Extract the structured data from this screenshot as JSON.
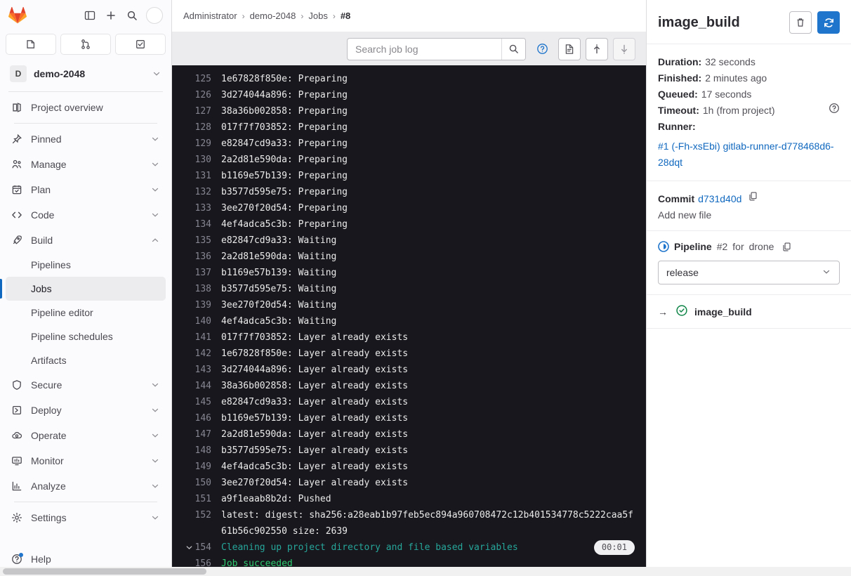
{
  "sidebar": {
    "logo_icon": "gitlab-logo",
    "top_buttons": [
      {
        "name": "toggle-sidebar-button",
        "icon": "panel-icon"
      },
      {
        "name": "create-new-button",
        "icon": "plus-icon"
      },
      {
        "name": "search-button",
        "icon": "search-icon"
      }
    ],
    "avatar": "user-avatar",
    "tabs": [
      {
        "name": "issues-tab",
        "icon": "issues-icon"
      },
      {
        "name": "merge-requests-tab",
        "icon": "merge-request-icon"
      },
      {
        "name": "todos-tab",
        "icon": "todo-checkbox-icon"
      }
    ],
    "project": {
      "badge": "D",
      "name": "demo-2048",
      "chevron": "chevron-down-icon"
    },
    "overview_label": "Project overview",
    "items": [
      {
        "label": "Pinned",
        "icon": "pin-icon",
        "expandable": true,
        "expanded": false
      },
      {
        "label": "Manage",
        "icon": "users-icon",
        "expandable": true,
        "expanded": false
      },
      {
        "label": "Plan",
        "icon": "calendar-icon",
        "expandable": true,
        "expanded": false
      },
      {
        "label": "Code",
        "icon": "code-icon",
        "expandable": true,
        "expanded": false
      },
      {
        "label": "Build",
        "icon": "rocket-icon",
        "expandable": true,
        "expanded": true
      },
      {
        "label": "Secure",
        "icon": "shield-icon",
        "expandable": true,
        "expanded": false
      },
      {
        "label": "Deploy",
        "icon": "deploy-icon",
        "expandable": true,
        "expanded": false
      },
      {
        "label": "Operate",
        "icon": "cloud-gear-icon",
        "expandable": true,
        "expanded": false
      },
      {
        "label": "Monitor",
        "icon": "monitor-icon",
        "expandable": true,
        "expanded": false
      },
      {
        "label": "Analyze",
        "icon": "chart-icon",
        "expandable": true,
        "expanded": false
      },
      {
        "label": "Settings",
        "icon": "gear-icon",
        "expandable": true,
        "expanded": false
      }
    ],
    "build_subitems": [
      {
        "label": "Pipelines",
        "active": false
      },
      {
        "label": "Jobs",
        "active": true
      },
      {
        "label": "Pipeline editor",
        "active": false
      },
      {
        "label": "Pipeline schedules",
        "active": false
      },
      {
        "label": "Artifacts",
        "active": false
      }
    ],
    "help_label": "Help"
  },
  "breadcrumb": {
    "items": [
      "Administrator",
      "demo-2048",
      "Jobs"
    ],
    "current": "#8",
    "separator": "›"
  },
  "toolbar": {
    "search_placeholder": "Search job log",
    "search_value": "",
    "buttons": [
      {
        "name": "search-submit-button",
        "icon": "search-icon"
      },
      {
        "name": "job-log-help-button",
        "icon": "question-circle-icon"
      },
      {
        "name": "raw-log-button",
        "icon": "document-icon"
      },
      {
        "name": "scroll-to-top-button",
        "icon": "arrow-up-icon"
      },
      {
        "name": "scroll-to-bottom-button",
        "icon": "arrow-down-icon"
      }
    ]
  },
  "job_log": {
    "lines": [
      {
        "num": "125",
        "text": "1e67828f850e: Preparing",
        "style": "plain"
      },
      {
        "num": "126",
        "text": "3d274044a896: Preparing",
        "style": "plain"
      },
      {
        "num": "127",
        "text": "38a36b002858: Preparing",
        "style": "plain"
      },
      {
        "num": "128",
        "text": "017f7f703852: Preparing",
        "style": "plain"
      },
      {
        "num": "129",
        "text": "e82847cd9a33: Preparing",
        "style": "plain"
      },
      {
        "num": "130",
        "text": "2a2d81e590da: Preparing",
        "style": "plain"
      },
      {
        "num": "131",
        "text": "b1169e57b139: Preparing",
        "style": "plain"
      },
      {
        "num": "132",
        "text": "b3577d595e75: Preparing",
        "style": "plain"
      },
      {
        "num": "133",
        "text": "3ee270f20d54: Preparing",
        "style": "plain"
      },
      {
        "num": "134",
        "text": "4ef4adca5c3b: Preparing",
        "style": "plain"
      },
      {
        "num": "135",
        "text": "e82847cd9a33: Waiting",
        "style": "plain"
      },
      {
        "num": "136",
        "text": "2a2d81e590da: Waiting",
        "style": "plain"
      },
      {
        "num": "137",
        "text": "b1169e57b139: Waiting",
        "style": "plain"
      },
      {
        "num": "138",
        "text": "b3577d595e75: Waiting",
        "style": "plain"
      },
      {
        "num": "139",
        "text": "3ee270f20d54: Waiting",
        "style": "plain"
      },
      {
        "num": "140",
        "text": "4ef4adca5c3b: Waiting",
        "style": "plain"
      },
      {
        "num": "141",
        "text": "017f7f703852: Layer already exists",
        "style": "plain"
      },
      {
        "num": "142",
        "text": "1e67828f850e: Layer already exists",
        "style": "plain"
      },
      {
        "num": "143",
        "text": "3d274044a896: Layer already exists",
        "style": "plain"
      },
      {
        "num": "144",
        "text": "38a36b002858: Layer already exists",
        "style": "plain"
      },
      {
        "num": "145",
        "text": "e82847cd9a33: Layer already exists",
        "style": "plain"
      },
      {
        "num": "146",
        "text": "b1169e57b139: Layer already exists",
        "style": "plain"
      },
      {
        "num": "147",
        "text": "2a2d81e590da: Layer already exists",
        "style": "plain"
      },
      {
        "num": "148",
        "text": "b3577d595e75: Layer already exists",
        "style": "plain"
      },
      {
        "num": "149",
        "text": "4ef4adca5c3b: Layer already exists",
        "style": "plain"
      },
      {
        "num": "150",
        "text": "3ee270f20d54: Layer already exists",
        "style": "plain"
      },
      {
        "num": "151",
        "text": "a9f1eaab8b2d: Pushed",
        "style": "plain"
      },
      {
        "num": "152",
        "text": "latest: digest: sha256:a28eab1b97feb5ec894a960708472c12b401534778c5222caa5f61b56c902550 size: 2639",
        "style": "plain"
      },
      {
        "num": "154",
        "text": "Cleaning up project directory and file based variables",
        "style": "cyan",
        "collapsible": true,
        "duration": "00:01"
      },
      {
        "num": "156",
        "text": "Job succeeded",
        "style": "green"
      }
    ]
  },
  "right_panel": {
    "title": "image_build",
    "erase_button": {
      "name": "erase-job-log-button",
      "icon": "trash-icon"
    },
    "retry_button": {
      "name": "retry-job-button",
      "icon": "retry-icon"
    },
    "details": [
      {
        "label": "Duration:",
        "value": "32 seconds"
      },
      {
        "label": "Finished:",
        "value": "2 minutes ago"
      },
      {
        "label": "Queued:",
        "value": "17 seconds"
      },
      {
        "label": "Timeout:",
        "value": "1h (from project)",
        "help": true
      }
    ],
    "runner": {
      "label": "Runner:",
      "link": "#1 (-Fh-xsEbi) gitlab-runner-d778468d6-28dqt"
    },
    "commit": {
      "label": "Commit",
      "sha": "d731d40d",
      "message": "Add new file",
      "copy_icon": "copy-icon"
    },
    "pipeline": {
      "status_icon": "pipeline-running-icon",
      "label": "Pipeline",
      "number": "#2",
      "for_text": "for",
      "ref": "drone",
      "copy_icon": "copy-icon"
    },
    "stage_select": {
      "value": "release",
      "chevron": "chevron-down-icon"
    },
    "jobs": [
      {
        "arrow": "→",
        "status_icon": "status-success-icon",
        "name": "image_build"
      }
    ]
  }
}
